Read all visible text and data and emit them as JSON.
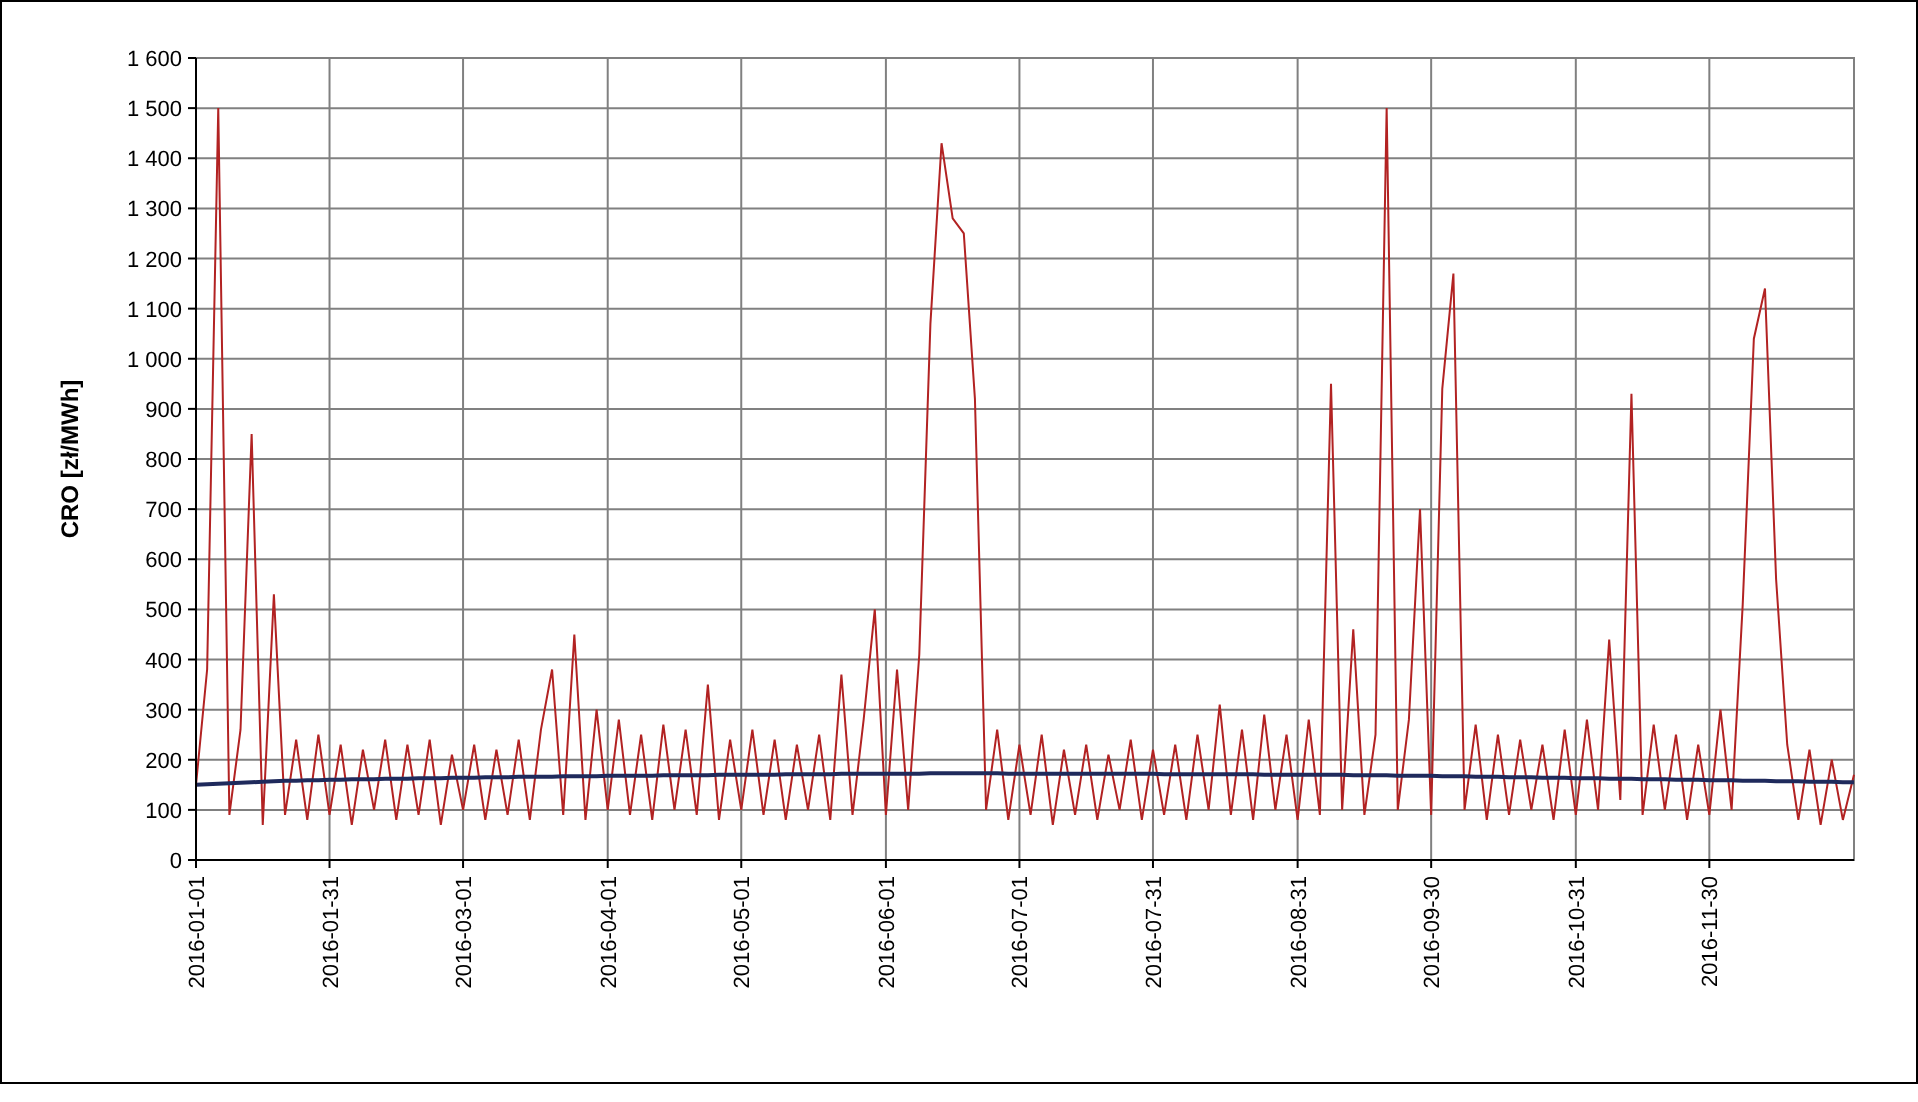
{
  "chart": {
    "chart_data": {
      "type": "line",
      "ylabel": "CRO [zł/MWh]",
      "ylim": [
        0,
        1600
      ],
      "grid": true,
      "categories": [
        "2016-01-01",
        null,
        null,
        null,
        null,
        null,
        null,
        null,
        null,
        null,
        null,
        null,
        "2016-01-31",
        null,
        null,
        null,
        null,
        null,
        null,
        null,
        null,
        null,
        null,
        null,
        "2016-03-01",
        null,
        null,
        null,
        null,
        null,
        null,
        null,
        null,
        null,
        null,
        null,
        null,
        "2016-04-01",
        null,
        null,
        null,
        null,
        null,
        null,
        null,
        null,
        null,
        null,
        null,
        "2016-05-01",
        null,
        null,
        null,
        null,
        null,
        null,
        null,
        null,
        null,
        null,
        null,
        null,
        "2016-06-01",
        null,
        null,
        null,
        null,
        null,
        null,
        null,
        null,
        null,
        null,
        null,
        "2016-07-01",
        null,
        null,
        null,
        null,
        null,
        null,
        null,
        null,
        null,
        null,
        null,
        "2016-07-31",
        null,
        null,
        null,
        null,
        null,
        null,
        null,
        null,
        null,
        null,
        null,
        null,
        "2016-08-31",
        null,
        null,
        null,
        null,
        null,
        null,
        null,
        null,
        null,
        null,
        null,
        "2016-09-30",
        null,
        null,
        null,
        null,
        null,
        null,
        null,
        null,
        null,
        null,
        null,
        null,
        "2016-10-31",
        null,
        null,
        null,
        null,
        null,
        null,
        null,
        null,
        null,
        null,
        null,
        "2016-11-30",
        null,
        null,
        null,
        null,
        null,
        null,
        null,
        null,
        null,
        null,
        null,
        null,
        null
      ],
      "yticks": [
        {
          "value": 0,
          "label": "0"
        },
        {
          "value": 100,
          "label": "100"
        },
        {
          "value": 200,
          "label": "200"
        },
        {
          "value": 300,
          "label": "300"
        },
        {
          "value": 400,
          "label": "400"
        },
        {
          "value": 500,
          "label": "500"
        },
        {
          "value": 600,
          "label": "600"
        },
        {
          "value": 700,
          "label": "700"
        },
        {
          "value": 800,
          "label": "800"
        },
        {
          "value": 900,
          "label": "900"
        },
        {
          "value": 1000,
          "label": "1 000"
        },
        {
          "value": 1100,
          "label": "1 100"
        },
        {
          "value": 1200,
          "label": "1 200"
        },
        {
          "value": 1300,
          "label": "1 300"
        },
        {
          "value": 1400,
          "label": "1 400"
        },
        {
          "value": 1500,
          "label": "1 500"
        },
        {
          "value": 1600,
          "label": "1 600"
        }
      ],
      "series": [
        {
          "color": "#b22222",
          "values": [
            150,
            380,
            1500,
            90,
            260,
            850,
            70,
            530,
            90,
            240,
            80,
            250,
            90,
            230,
            70,
            220,
            100,
            240,
            80,
            230,
            90,
            240,
            70,
            210,
            100,
            230,
            80,
            220,
            90,
            240,
            80,
            260,
            380,
            90,
            450,
            80,
            300,
            100,
            280,
            90,
            250,
            80,
            270,
            100,
            260,
            90,
            350,
            80,
            240,
            100,
            260,
            90,
            240,
            80,
            230,
            100,
            250,
            80,
            370,
            90,
            280,
            500,
            90,
            380,
            100,
            410,
            1070,
            1430,
            1280,
            1250,
            920,
            100,
            260,
            80,
            230,
            90,
            250,
            70,
            220,
            90,
            230,
            80,
            210,
            100,
            240,
            80,
            220,
            90,
            230,
            80,
            250,
            100,
            310,
            90,
            260,
            80,
            290,
            100,
            250,
            80,
            280,
            90,
            950,
            100,
            460,
            90,
            250,
            1500,
            100,
            280,
            700,
            90,
            940,
            1170,
            100,
            270,
            80,
            250,
            90,
            240,
            100,
            230,
            80,
            260,
            90,
            280,
            100,
            440,
            120,
            930,
            90,
            270,
            100,
            250,
            80,
            230,
            90,
            300,
            100,
            510,
            1040,
            1140,
            560,
            230,
            80,
            220,
            70,
            200,
            80,
            170
          ]
        },
        {
          "color": "#1f2a5c",
          "values": [
            150,
            151,
            152,
            153,
            154,
            155,
            156,
            157,
            158,
            158,
            159,
            159,
            160,
            160,
            161,
            161,
            161,
            162,
            162,
            162,
            163,
            163,
            163,
            164,
            164,
            164,
            165,
            165,
            165,
            166,
            166,
            166,
            166,
            167,
            167,
            167,
            167,
            168,
            168,
            168,
            168,
            168,
            169,
            169,
            169,
            169,
            169,
            170,
            170,
            170,
            170,
            170,
            170,
            171,
            171,
            171,
            171,
            171,
            172,
            172,
            172,
            172,
            172,
            172,
            172,
            172,
            173,
            173,
            173,
            173,
            173,
            173,
            173,
            172,
            172,
            172,
            172,
            172,
            172,
            172,
            172,
            172,
            172,
            172,
            172,
            172,
            172,
            171,
            171,
            171,
            171,
            171,
            171,
            171,
            171,
            171,
            170,
            170,
            170,
            170,
            170,
            170,
            170,
            170,
            169,
            169,
            169,
            169,
            168,
            168,
            168,
            168,
            167,
            167,
            167,
            166,
            166,
            166,
            165,
            165,
            165,
            164,
            164,
            164,
            163,
            163,
            163,
            162,
            162,
            162,
            161,
            161,
            161,
            160,
            160,
            160,
            159,
            159,
            159,
            158,
            158,
            158,
            157,
            157,
            157,
            156,
            156,
            156,
            155,
            155
          ]
        }
      ]
    }
  }
}
